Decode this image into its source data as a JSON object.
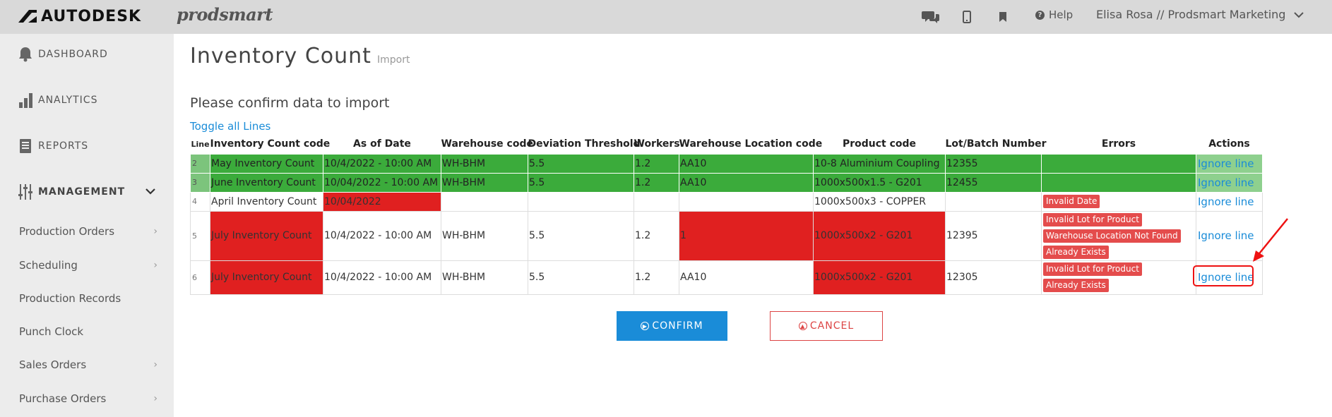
{
  "topbar": {
    "brand": "AUTODESK",
    "product": "prodsmart",
    "help_label": "Help",
    "user_label": "Elisa Rosa // Prodsmart Marketing",
    "icons": [
      "chat-icon",
      "mobile-icon",
      "bookmark-icon",
      "help-icon",
      "chevron-down-icon"
    ]
  },
  "sidebar": {
    "main_items": [
      {
        "label": "DASHBOARD",
        "icon": "bell-icon"
      },
      {
        "label": "ANALYTICS",
        "icon": "bar-chart-icon"
      },
      {
        "label": "REPORTS",
        "icon": "document-icon"
      },
      {
        "label": "MANAGEMENT",
        "icon": "sliders-icon"
      }
    ],
    "sub_items": [
      {
        "label": "Production Orders",
        "has_chevron": true
      },
      {
        "label": "Scheduling",
        "has_chevron": true
      },
      {
        "label": "Production Records",
        "has_chevron": false
      },
      {
        "label": "Punch Clock",
        "has_chevron": false
      },
      {
        "label": "Sales Orders",
        "has_chevron": true
      },
      {
        "label": "Purchase Orders",
        "has_chevron": true
      }
    ]
  },
  "main": {
    "title": "Inventory Count",
    "subtitle": "Import",
    "heading": "Please confirm data to import",
    "toggle_label": "Toggle all Lines",
    "columns": [
      "Line",
      "Inventory Count code",
      "As of Date",
      "Warehouse code",
      "Deviation Threshold",
      "Workers",
      "Warehouse Location code",
      "Product code",
      "Lot/Batch Number",
      "Errors",
      "Actions"
    ],
    "rows": [
      {
        "line": "2",
        "code": "May Inventory Count",
        "date": "10/4/2022 - 10:00 AM",
        "warehouse": "WH-BHM",
        "threshold": "5.5",
        "workers": "1.2",
        "location": "AA10",
        "product": "10-8 Aluminium Coupling",
        "lot": "12355",
        "errors": [],
        "action": "Ignore line",
        "status": "ok",
        "invalid": []
      },
      {
        "line": "3",
        "code": "June Inventory Count",
        "date": "10/04/2022 - 10:00 AM",
        "warehouse": "WH-BHM",
        "threshold": "5.5",
        "workers": "1.2",
        "location": "AA10",
        "product": "1000x500x1.5 - G201",
        "lot": "12455",
        "errors": [],
        "action": "Ignore line",
        "status": "ok",
        "invalid": []
      },
      {
        "line": "4",
        "code": "April Inventory Count",
        "date": "10/04/2022",
        "warehouse": "",
        "threshold": "",
        "workers": "",
        "location": "",
        "product": "1000x500x3 - COPPER",
        "lot": "",
        "errors": [
          "Invalid Date"
        ],
        "action": "Ignore line",
        "status": "error",
        "invalid": [
          "date"
        ]
      },
      {
        "line": "5",
        "code": "July Inventory Count",
        "date": "10/4/2022 - 10:00 AM",
        "warehouse": "WH-BHM",
        "threshold": "5.5",
        "workers": "1.2",
        "location": "1",
        "product": "1000x500x2 - G201",
        "lot": "12395",
        "errors": [
          "Invalid Lot for Product",
          "Warehouse Location Not Found",
          "Already Exists"
        ],
        "action": "Ignore line",
        "status": "error",
        "invalid": [
          "code",
          "location",
          "product"
        ]
      },
      {
        "line": "6",
        "code": "July Inventory Count",
        "date": "10/4/2022 - 10:00 AM",
        "warehouse": "WH-BHM",
        "threshold": "5.5",
        "workers": "1.2",
        "location": "AA10",
        "product": "1000x500x2 - G201",
        "lot": "12305",
        "errors": [
          "Invalid Lot for Product",
          "Already Exists"
        ],
        "action": "Ignore line",
        "status": "error",
        "invalid": [
          "code",
          "product"
        ]
      }
    ],
    "confirm_label": "CONFIRM",
    "cancel_label": "CANCEL"
  },
  "colors": {
    "ok_row": "#3bab3b",
    "invalid_cell": "#e02020",
    "error_badge": "#e44c4c",
    "link": "#1a8cd8",
    "annotation": "#ee1111"
  }
}
